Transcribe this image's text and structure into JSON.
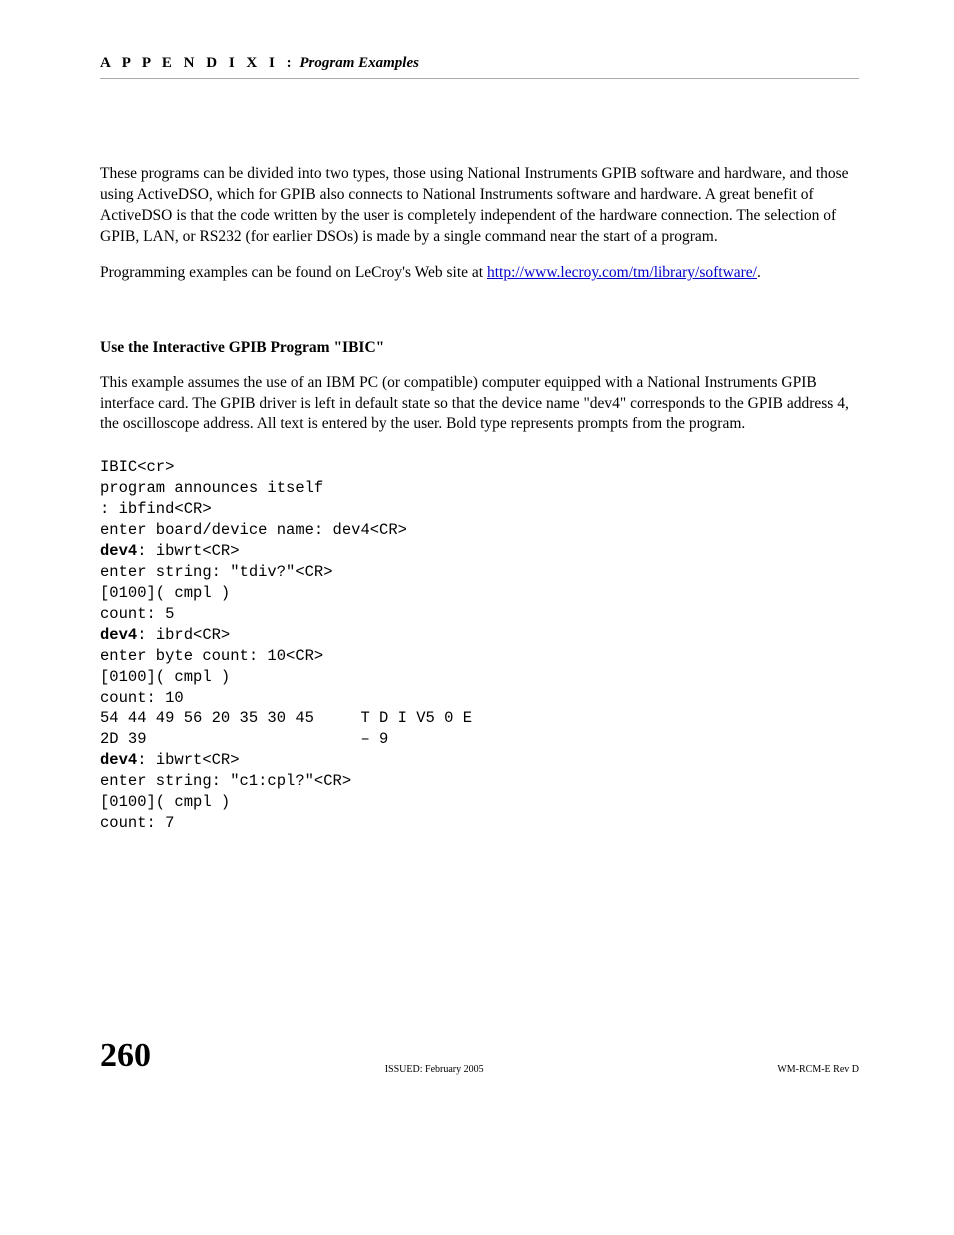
{
  "header": {
    "appendix": "A P P E N D I X   I :",
    "title": "  Program Examples"
  },
  "para1": "These programs can be divided into two types, those using National Instruments GPIB software and hardware, and those using ActiveDSO, which for GPIB also connects to National Instruments software and hardware. A great benefit of ActiveDSO is that the code written by the user is completely independent of the hardware connection. The selection of GPIB, LAN, or RS232 (for earlier DSOs) is made by a single command near the start of a program.",
  "para2_prefix": "Programming examples can be found on LeCroy's Web site at ",
  "para2_link": "http://www.lecroy.com/tm/library/software/",
  "para2_suffix": ".",
  "subhead": "Use the Interactive GPIB Program \"IBIC\"",
  "para3": "This example assumes the use of an IBM PC (or compatible) computer equipped with a National Instruments GPIB interface card. The GPIB driver is left in default state so that the device name \"dev4\" corresponds to the GPIB address 4, the oscilloscope address. All text is entered by the user. Bold type represents prompts from the program.",
  "code": {
    "l1": "IBIC<cr>",
    "l2": "program announces itself",
    "l3": ": ibfind<CR>",
    "l4": "enter board/device name: dev4<CR>",
    "l5a": "dev4",
    "l5b": ": ibwrt<CR>",
    "l6": "enter string: \"tdiv?\"<CR>",
    "l7": "[0100]( cmpl )",
    "l8": "count: 5",
    "l9a": "dev4",
    "l9b": ": ibrd<CR>",
    "l10": "enter byte count: 10<CR>",
    "l11": "[0100]( cmpl )",
    "l12": "count: 10",
    "l13": "54 44 49 56 20 35 30 45     T D I V5 0 E",
    "l14": "2D 39                       – 9",
    "l15a": "dev4",
    "l15b": ": ibwrt<CR>",
    "l16": "enter string: \"c1:cpl?\"<CR>",
    "l17": "[0100]( cmpl )",
    "l18": "count: 7"
  },
  "footer": {
    "page": "260",
    "issued": "ISSUED: February 2005",
    "rev": "WM-RCM-E Rev D"
  }
}
